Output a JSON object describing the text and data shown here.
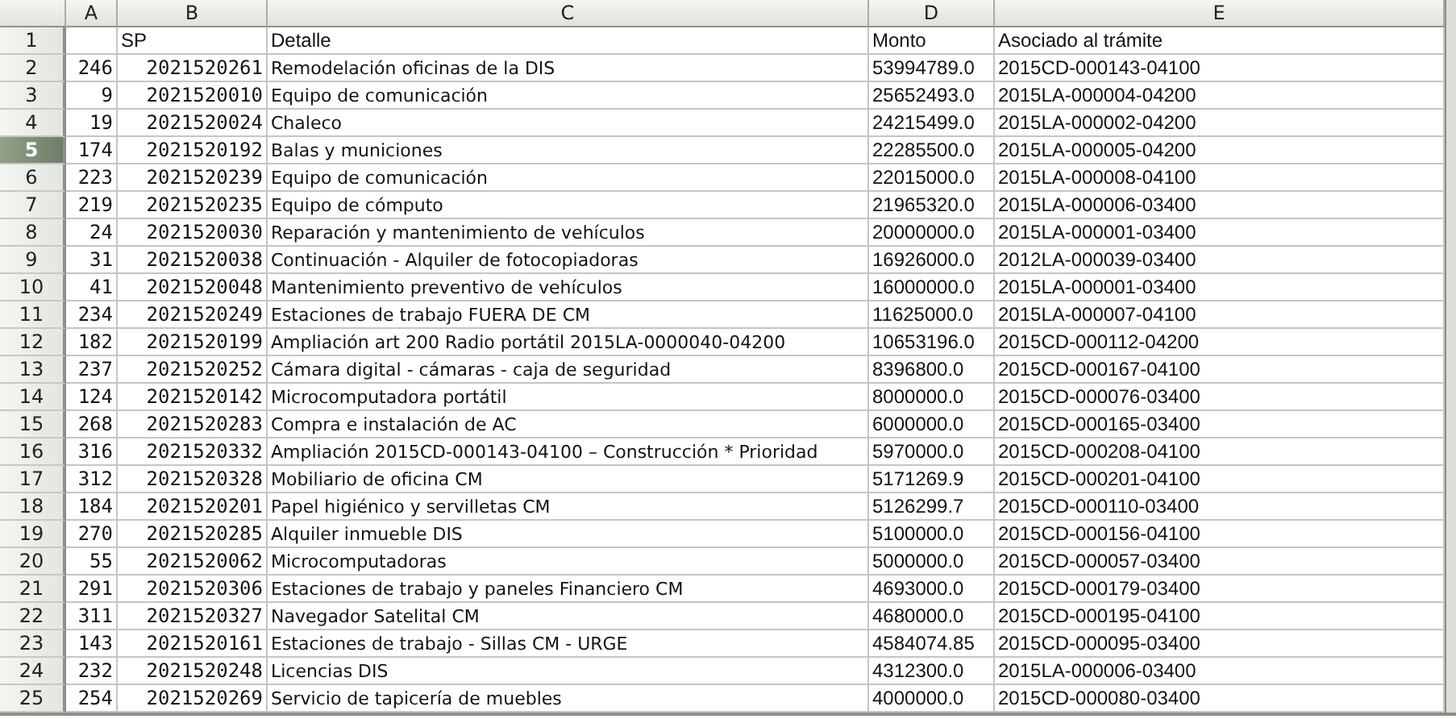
{
  "columns": [
    {
      "label": "A",
      "selected": false
    },
    {
      "label": "B",
      "selected": false
    },
    {
      "label": "C",
      "selected": false
    },
    {
      "label": "D",
      "selected": false
    },
    {
      "label": "E",
      "selected": false
    }
  ],
  "rows": [
    {
      "number": "1",
      "selected": false,
      "kind": "header",
      "cells": {
        "b": "SP",
        "c": "Detalle",
        "d": "Monto",
        "e": "Asociado al trámite"
      }
    },
    {
      "number": "2",
      "selected": false,
      "kind": "data",
      "cells": {
        "a": "246",
        "b": "2021520261",
        "c": "Remodelación oficinas de la DIS",
        "d": "53994789.0",
        "e": "2015CD-000143-04100"
      }
    },
    {
      "number": "3",
      "selected": false,
      "kind": "data",
      "cells": {
        "a": "9",
        "b": "2021520010",
        "c": "Equipo de comunicación",
        "d": "25652493.0",
        "e": "2015LA-000004-04200"
      }
    },
    {
      "number": "4",
      "selected": false,
      "kind": "data",
      "cells": {
        "a": "19",
        "b": "2021520024",
        "c": "Chaleco",
        "d": "24215499.0",
        "e": "2015LA-000002-04200"
      }
    },
    {
      "number": "5",
      "selected": true,
      "kind": "data",
      "cells": {
        "a": "174",
        "b": "2021520192",
        "c": "Balas y municiones",
        "d": "22285500.0",
        "e": "2015LA-000005-04200"
      }
    },
    {
      "number": "6",
      "selected": false,
      "kind": "data",
      "cells": {
        "a": "223",
        "b": "2021520239",
        "c": "Equipo de comunicación",
        "d": "22015000.0",
        "e": "2015LA-000008-04100"
      }
    },
    {
      "number": "7",
      "selected": false,
      "kind": "data",
      "cells": {
        "a": "219",
        "b": "2021520235",
        "c": "Equipo de cómputo",
        "d": "21965320.0",
        "e": "2015LA-000006-03400"
      }
    },
    {
      "number": "8",
      "selected": false,
      "kind": "data",
      "cells": {
        "a": "24",
        "b": "2021520030",
        "c": "Reparación y mantenimiento de vehículos",
        "d": "20000000.0",
        "e": "2015LA-000001-03400"
      }
    },
    {
      "number": "9",
      "selected": false,
      "kind": "data",
      "cells": {
        "a": "31",
        "b": "2021520038",
        "c": "Continuación - Alquiler de fotocopiadoras",
        "d": "16926000.0",
        "e": "2012LA-000039-03400"
      }
    },
    {
      "number": "10",
      "selected": false,
      "kind": "data",
      "cells": {
        "a": "41",
        "b": "2021520048",
        "c": "Mantenimiento preventivo de vehículos",
        "d": "16000000.0",
        "e": "2015LA-000001-03400"
      }
    },
    {
      "number": "11",
      "selected": false,
      "kind": "data",
      "cells": {
        "a": "234",
        "b": "2021520249",
        "c": "Estaciones de trabajo FUERA DE CM",
        "d": "11625000.0",
        "e": "2015LA-000007-04100"
      }
    },
    {
      "number": "12",
      "selected": false,
      "kind": "data",
      "cells": {
        "a": "182",
        "b": "2021520199",
        "c": "Ampliación art 200 Radio portátil 2015LA-0000040-04200",
        "d": "10653196.0",
        "e": "2015CD-000112-04200"
      }
    },
    {
      "number": "13",
      "selected": false,
      "kind": "data",
      "cells": {
        "a": "237",
        "b": "2021520252",
        "c": "Cámara digital - cámaras - caja de seguridad",
        "d": "8396800.0",
        "e": "2015CD-000167-04100"
      }
    },
    {
      "number": "14",
      "selected": false,
      "kind": "data",
      "cells": {
        "a": "124",
        "b": "2021520142",
        "c": "Microcomputadora portátil",
        "d": "8000000.0",
        "e": "2015CD-000076-03400"
      }
    },
    {
      "number": "15",
      "selected": false,
      "kind": "data",
      "cells": {
        "a": "268",
        "b": "2021520283",
        "c": "Compra e instalación de AC",
        "d": "6000000.0",
        "e": "2015CD-000165-03400"
      }
    },
    {
      "number": "16",
      "selected": false,
      "kind": "data",
      "cells": {
        "a": "316",
        "b": "2021520332",
        "c": "Ampliación 2015CD-000143-04100 – Construcción * Prioridad",
        "d": "5970000.0",
        "e": "2015CD-000208-04100"
      }
    },
    {
      "number": "17",
      "selected": false,
      "kind": "data",
      "cells": {
        "a": "312",
        "b": "2021520328",
        "c": "Mobiliario de oficina CM",
        "d": "5171269.9",
        "e": "2015CD-000201-04100"
      }
    },
    {
      "number": "18",
      "selected": false,
      "kind": "data",
      "cells": {
        "a": "184",
        "b": "2021520201",
        "c": "Papel higiénico y servilletas CM",
        "d": "5126299.7",
        "e": "2015CD-000110-03400"
      }
    },
    {
      "number": "19",
      "selected": false,
      "kind": "data",
      "cells": {
        "a": "270",
        "b": "2021520285",
        "c": "Alquiler inmueble DIS",
        "d": "5100000.0",
        "e": "2015CD-000156-04100"
      }
    },
    {
      "number": "20",
      "selected": false,
      "kind": "data",
      "cells": {
        "a": "55",
        "b": "2021520062",
        "c": "Microcomputadoras",
        "d": "5000000.0",
        "e": "2015CD-000057-03400"
      }
    },
    {
      "number": "21",
      "selected": false,
      "kind": "data",
      "cells": {
        "a": "291",
        "b": "2021520306",
        "c": "Estaciones de trabajo y paneles Financiero CM",
        "d": "4693000.0",
        "e": "2015CD-000179-03400"
      }
    },
    {
      "number": "22",
      "selected": false,
      "kind": "data",
      "cells": {
        "a": "311",
        "b": "2021520327",
        "c": "Navegador Satelital CM",
        "d": "4680000.0",
        "e": "2015CD-000195-04100"
      }
    },
    {
      "number": "23",
      "selected": false,
      "kind": "data",
      "cells": {
        "a": "143",
        "b": "2021520161",
        "c": "Estaciones de trabajo - Sillas CM - URGE",
        "d": "4584074.85",
        "e": "2015CD-000095-03400"
      }
    },
    {
      "number": "24",
      "selected": false,
      "kind": "data",
      "cells": {
        "a": "232",
        "b": "2021520248",
        "c": "Licencias DIS",
        "d": "4312300.0",
        "e": "2015LA-000006-03400"
      }
    },
    {
      "number": "25",
      "selected": false,
      "kind": "data",
      "cells": {
        "a": "254",
        "b": "2021520269",
        "c": "Servicio de tapicería de muebles",
        "d": "4000000.0",
        "e": "2015CD-000080-03400"
      }
    }
  ]
}
